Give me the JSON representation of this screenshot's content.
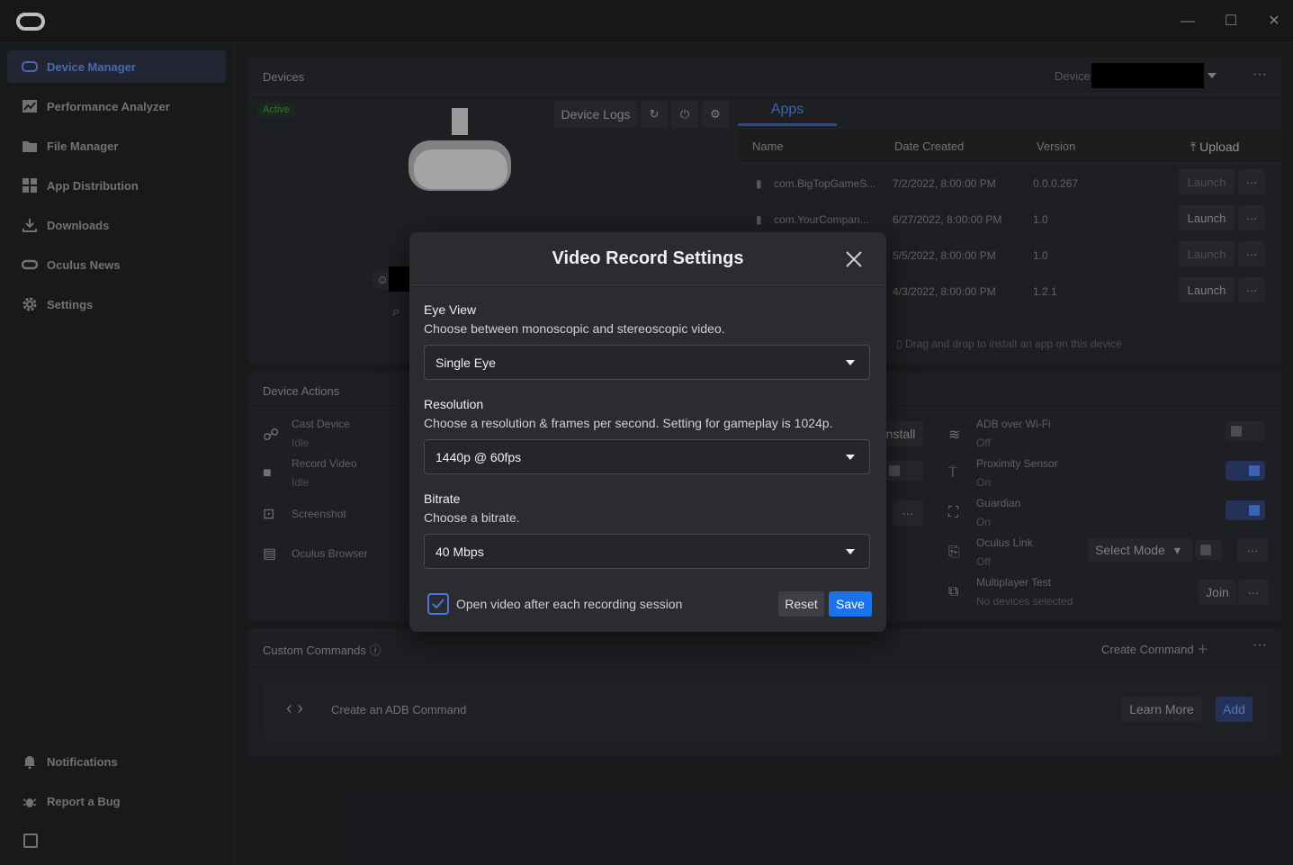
{
  "sidebar": {
    "items": [
      {
        "label": "Device Manager",
        "icon": "headset-icon"
      },
      {
        "label": "Performance Analyzer",
        "icon": "chart-icon"
      },
      {
        "label": "File Manager",
        "icon": "folder-icon"
      },
      {
        "label": "App Distribution",
        "icon": "grid-icon"
      },
      {
        "label": "Downloads",
        "icon": "download-icon"
      },
      {
        "label": "Oculus News",
        "icon": "oculus-icon"
      },
      {
        "label": "Settings",
        "icon": "gear-icon"
      }
    ],
    "bottom": [
      {
        "label": "Notifications",
        "icon": "bell-icon"
      },
      {
        "label": "Report a Bug",
        "icon": "bug-icon"
      }
    ]
  },
  "devices": {
    "title": "Devices",
    "status": "Active",
    "device_label": "Device",
    "logs_label": "Device Logs"
  },
  "apps": {
    "tab": "Apps",
    "upload": "Upload",
    "columns": [
      "Name",
      "Date Created",
      "Version"
    ],
    "rows": [
      {
        "name": "com.BigTopGameS...",
        "date": "7/2/2022, 8:00:00 PM",
        "version": "0.0.0.267",
        "launch": "Launch"
      },
      {
        "name": "com.YourCompan...",
        "date": "6/27/2022, 8:00:00 PM",
        "version": "1.0",
        "launch": "Launch"
      },
      {
        "name": "",
        "date": "5/5/2022, 8:00:00 PM",
        "version": "1.0",
        "launch": "Launch"
      },
      {
        "name": "",
        "date": "4/3/2022, 8:00:00 PM",
        "version": "1.2.1",
        "launch": "Launch"
      }
    ],
    "drop_hint": "Drag and drop to install an app on this device"
  },
  "actions": {
    "title": "Device Actions",
    "install": "nstall",
    "left": [
      {
        "label": "Cast Device",
        "sub": "Idle"
      },
      {
        "label": "Record Video",
        "sub": "Idle"
      },
      {
        "label": "Screenshot",
        "sub": ""
      },
      {
        "label": "Oculus Browser",
        "sub": ""
      }
    ],
    "right": [
      {
        "label": "ADB over Wi-Fi",
        "sub": "Off"
      },
      {
        "label": "Proximity Sensor",
        "sub": "On"
      },
      {
        "label": "Guardian",
        "sub": "On"
      },
      {
        "label": "Oculus Link",
        "sub": "Off"
      },
      {
        "label": "Multiplayer Test",
        "sub": "No devices selected"
      }
    ],
    "select_mode": "Select Mode",
    "join": "Join"
  },
  "custom": {
    "title": "Custom Commands",
    "create": "Create Command",
    "placeholder": "Create an ADB Command",
    "learn": "Learn More",
    "add": "Add"
  },
  "modal": {
    "title": "Video Record Settings",
    "eye_label": "Eye View",
    "eye_desc": "Choose between monoscopic and stereoscopic video.",
    "eye_value": "Single Eye",
    "res_label": "Resolution",
    "res_desc": "Choose a resolution & frames per second. Setting for gameplay is 1024p.",
    "res_value": "1440p @ 60fps",
    "bit_label": "Bitrate",
    "bit_desc": "Choose a bitrate.",
    "bit_value": "40 Mbps",
    "open_after": "Open video after each recording session",
    "reset": "Reset",
    "save": "Save"
  },
  "colors": {
    "accent": "#4a78e0",
    "save": "#1a73e8"
  }
}
